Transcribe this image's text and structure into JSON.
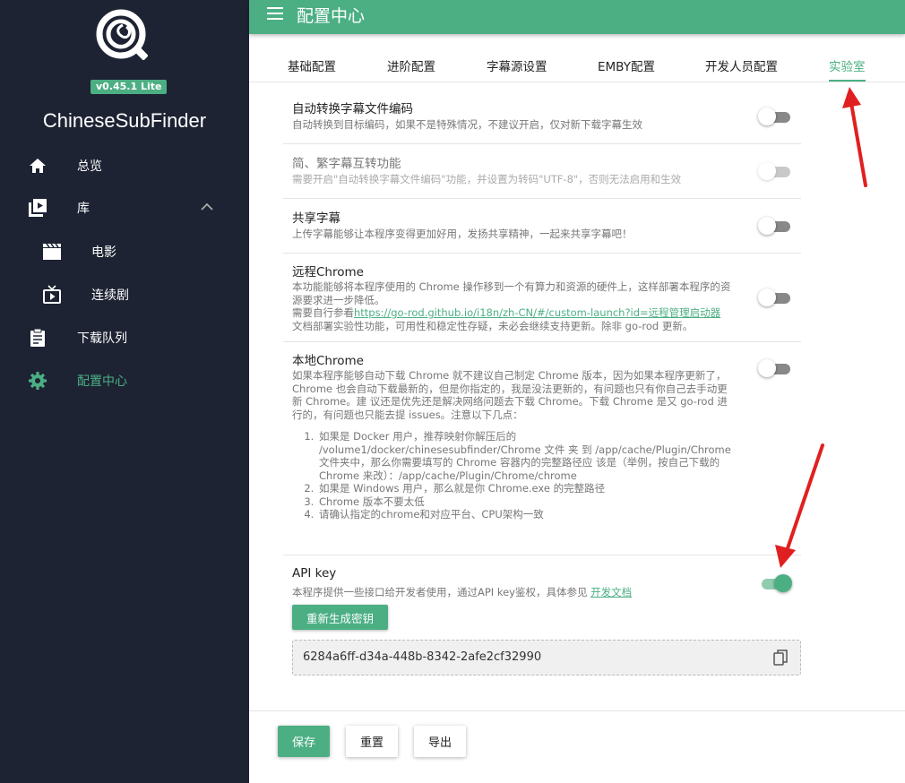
{
  "app": {
    "name": "ChineseSubFinder",
    "version": "v0.45.1 Lite"
  },
  "sidebar": {
    "items": [
      {
        "label": "总览",
        "icon": "home-icon"
      },
      {
        "label": "库",
        "icon": "library-icon"
      },
      {
        "label": "电影",
        "icon": "movie-icon"
      },
      {
        "label": "连续剧",
        "icon": "tv-icon"
      },
      {
        "label": "下载队列",
        "icon": "clipboard-icon"
      },
      {
        "label": "配置中心",
        "icon": "gear-icon"
      }
    ]
  },
  "header": {
    "title": "配置中心"
  },
  "tabs": [
    {
      "label": "基础配置"
    },
    {
      "label": "进阶配置"
    },
    {
      "label": "字幕源设置"
    },
    {
      "label": "EMBY配置"
    },
    {
      "label": "开发人员配置"
    },
    {
      "label": "实验室",
      "active": true
    }
  ],
  "settings": {
    "auto_convert": {
      "title": "自动转换字幕文件编码",
      "desc": "自动转换到目标编码，如果不是特殊情况，不建议开启，仅对新下载字幕生效",
      "enabled": false
    },
    "simp_trad": {
      "title": "简、繁字幕互转功能",
      "desc": "需要开启\"自动转换字幕文件编码\"功能，并设置为转码\"UTF-8\"，否则无法启用和生效",
      "enabled": false,
      "disabled": true
    },
    "share_sub": {
      "title": "共享字幕",
      "desc": "上传字幕能够让本程序变得更加好用，发扬共享精神，一起来共享字幕吧！",
      "enabled": false
    },
    "remote_chrome": {
      "title": "远程Chrome",
      "desc_1": "本功能能够将本程序使用的 Chrome 操作移到一个有算力和资源的硬件上，这样部署本程序的资源要求进一步降低。",
      "desc_2": "需要自行参看",
      "link": "https://go-rod.github.io/i18n/zh-CN/#/custom-launch?id=远程管理启动器",
      "desc_3": "文档部署实验性功能，可用性和稳定性存疑，未必会继续支持更新。除非 go-rod 更新。",
      "enabled": false
    },
    "local_chrome": {
      "title": "本地Chrome",
      "desc": "如果本程序能够自动下载 Chrome 就不建议自己制定 Chrome 版本，因为如果本程序更新了， Chrome 也会自动下载最新的，但是你指定的，我是没法更新的，有问题也只有你自己去手动更新 Chrome。建 议还是优先还是解决网络问题去下载 Chrome。下载 Chrome 是又 go-rod 进行的，有问题也只能去提 issues。注意以下几点：",
      "items": [
        "如果是 Docker 用户，推荐映射你解压后的 /volume1/docker/chinesesubfinder/Chrome 文件 夹 到 /app/cache/Plugin/Chrome 文件夹中，那么你需要填写的 Chrome 容器内的完整路径应 该是（举例，按自己下载的 Chrome 来改）：/app/cache/Plugin/Chrome/chrome",
        "如果是 Windows 用户，那么就是你 Chrome.exe 的完整路径",
        "Chrome 版本不要太低",
        "请确认指定的chrome和对应平台、CPU架构一致"
      ],
      "enabled": false
    },
    "api_key": {
      "title": "API key",
      "desc": "本程序提供一些接口给开发者使用，通过API key鉴权，具体参见",
      "link": "开发文档",
      "enabled": true,
      "regen_label": "重新生成密钥",
      "key_value": "6284a6ff-d34a-448b-8342-2afe2cf32990"
    }
  },
  "footer": {
    "save": "保存",
    "reset": "重置",
    "export": "导出"
  },
  "colors": {
    "accent": "#4caf84",
    "sidebar_bg": "#1d2333",
    "annotation": "#e02020"
  }
}
